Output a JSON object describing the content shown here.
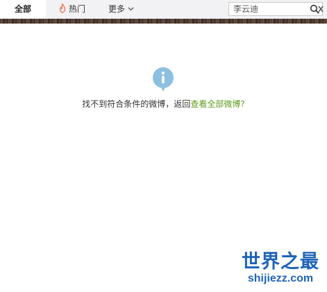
{
  "tabs": {
    "all_label": "全部",
    "hot_label": "热门",
    "more_label": "更多"
  },
  "search": {
    "value": "李云迪",
    "icon": "search-icon"
  },
  "empty_state": {
    "icon": "info-icon",
    "message": "找不到符合条件的微博，返回",
    "link_text": "查看全部微博?"
  },
  "watermark": {
    "title": "世界之最",
    "url": "shijiezz.com"
  },
  "colors": {
    "tabbar_bg": "#f2f2f5",
    "info_icon": "#8dbfe0",
    "link": "#5f9c1e",
    "flame": "#f0704a",
    "watermark": "#1f64b8"
  }
}
